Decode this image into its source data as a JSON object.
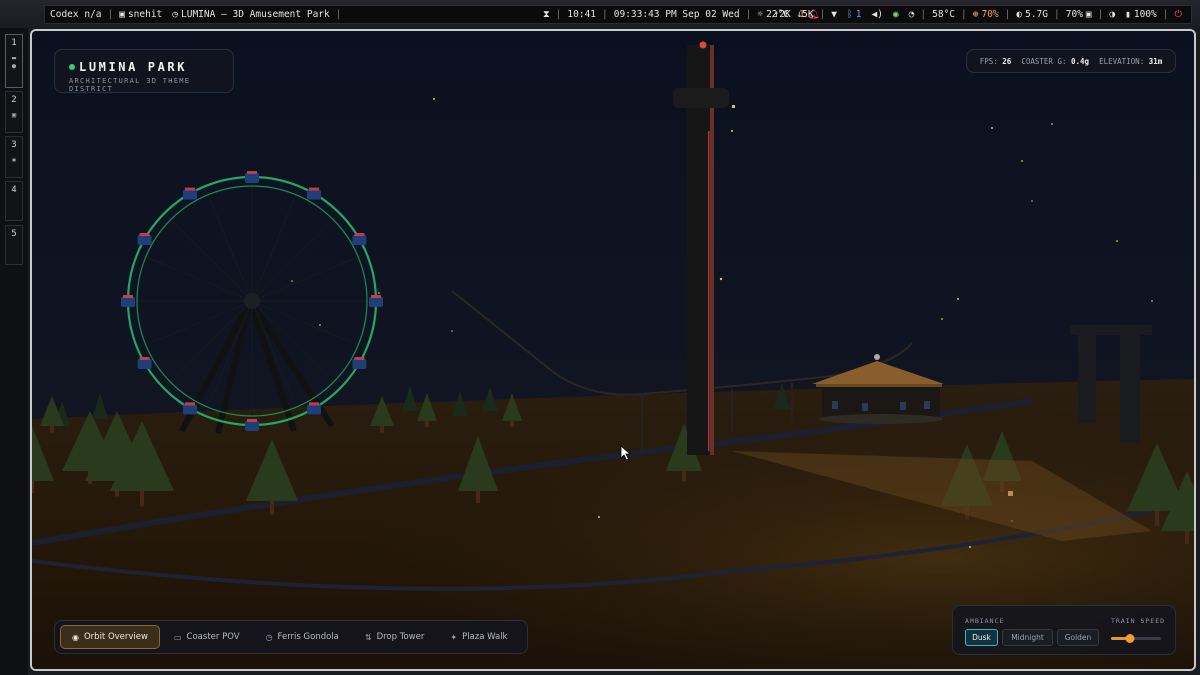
{
  "statusbar": {
    "app": "Codex n/a",
    "user": "snehit",
    "window_title": "LUMINA — 3D Amusement Park",
    "time_short": "10:41",
    "clock": "09:33:43 PM Sep 02 Wed",
    "weather": "22°C",
    "notifications": "1",
    "net": "↑2K ↓5K",
    "bluetooth": "1",
    "temp": "58°C",
    "cpu": "70%",
    "mem": "5.7G",
    "brightness": "70%",
    "battery": "100%"
  },
  "workspaces": [
    "1",
    "2",
    "3",
    "4",
    "5"
  ],
  "brand": {
    "title": "LUMINA PARK",
    "subtitle": "ARCHITECTURAL 3D THEME DISTRICT"
  },
  "stats": {
    "fps_label": "FPS:",
    "fps": "26",
    "g_label": "COASTER G:",
    "g": "0.4g",
    "elev_label": "ELEVATION:",
    "elev": "31m"
  },
  "cameras": [
    {
      "label": "Orbit Overview",
      "icon": "eye-icon",
      "active": true
    },
    {
      "label": "Coaster POV",
      "icon": "train-icon",
      "active": false
    },
    {
      "label": "Ferris Gondola",
      "icon": "clock-icon",
      "active": false
    },
    {
      "label": "Drop Tower",
      "icon": "arrows-icon",
      "active": false
    },
    {
      "label": "Plaza Walk",
      "icon": "walker-icon",
      "active": false
    }
  ],
  "ambiance": {
    "label": "AMBIANCE",
    "options": [
      "Dusk",
      "Midnight",
      "Golden"
    ],
    "selected": "Dusk",
    "speed_label": "TRAIN SPEED",
    "speed": 0.38
  },
  "colors": {
    "accent_orange": "#e09a30",
    "accent_cyan": "#2fb8cc",
    "ferris_ring": "#1fa866",
    "status_dot": "#2fd17a"
  }
}
